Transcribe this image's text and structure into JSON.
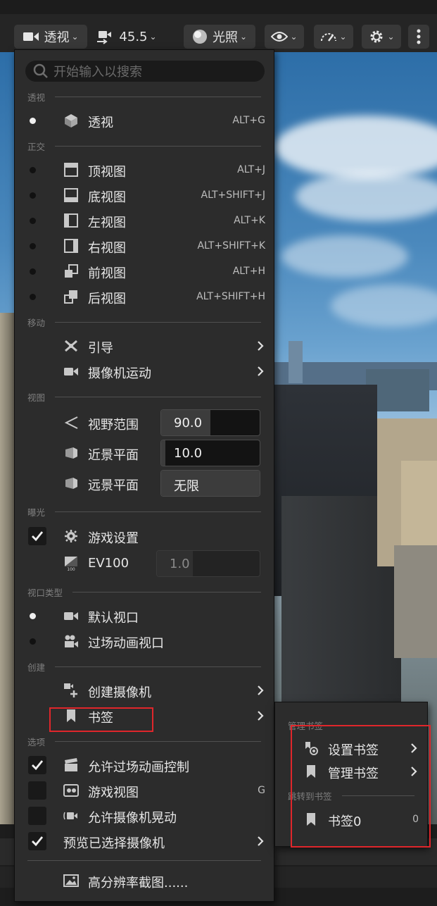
{
  "toolbar": {
    "perspective_label": "透视",
    "camera_speed": "45.5",
    "lighting_label": "光照"
  },
  "menu": {
    "search_placeholder": "开始输入以搜索",
    "sections": {
      "perspective": "透视",
      "ortho": "正交",
      "move": "移动",
      "view": "视图",
      "exposure": "曝光",
      "viewport_type": "视口类型",
      "create": "创建",
      "options": "选项"
    },
    "perspective": {
      "label": "透视",
      "shortcut": "ALT+G",
      "selected": true
    },
    "ortho_items": [
      {
        "label": "顶视图",
        "shortcut": "ALT+J",
        "icon": "top-view-icon"
      },
      {
        "label": "底视图",
        "shortcut": "ALT+SHIFT+J",
        "icon": "bottom-view-icon"
      },
      {
        "label": "左视图",
        "shortcut": "ALT+K",
        "icon": "left-view-icon"
      },
      {
        "label": "右视图",
        "shortcut": "ALT+SHIFT+K",
        "icon": "right-view-icon"
      },
      {
        "label": "前视图",
        "shortcut": "ALT+H",
        "icon": "front-view-icon"
      },
      {
        "label": "后视图",
        "shortcut": "ALT+SHIFT+H",
        "icon": "back-view-icon"
      }
    ],
    "move_items": [
      {
        "label": "引导",
        "icon": "pilot-icon"
      },
      {
        "label": "摄像机运动",
        "icon": "camera-movement-icon"
      }
    ],
    "view_items": [
      {
        "label": "视野范围",
        "value": "90.0",
        "fill": 0.5
      },
      {
        "label": "近景平面",
        "value": "10.0",
        "fill": 0.04
      },
      {
        "label": "远景平面",
        "value": "无限",
        "fill": 1.0
      }
    ],
    "exposure": {
      "game_settings_label": "游戏设置",
      "game_settings_checked": true,
      "ev100_label": "EV100",
      "ev100_icon_text": "100",
      "ev100_value": "1.0",
      "ev100_fill": 0.35
    },
    "viewport_types": [
      {
        "label": "默认视口",
        "selected": true
      },
      {
        "label": "过场动画视口",
        "selected": false
      }
    ],
    "create_items": [
      {
        "label": "创建摄像机"
      },
      {
        "label": "书签"
      }
    ],
    "options": [
      {
        "label": "允许过场动画控制",
        "checked": true,
        "shortcut": ""
      },
      {
        "label": "游戏视图",
        "checked": false,
        "shortcut": "G"
      },
      {
        "label": "允许摄像机晃动",
        "checked": false,
        "shortcut": ""
      },
      {
        "label": "预览已选择摄像机",
        "checked": true,
        "shortcut": ""
      }
    ],
    "screenshot_label": "高分辨率截图......"
  },
  "submenu": {
    "manage_section": "管理书签",
    "set_bookmark": "设置书签",
    "manage_bookmark": "管理书签",
    "jump_section": "跳转到书签",
    "bookmark0_label": "书签0",
    "bookmark0_shortcut": "0"
  },
  "colors": {
    "menu_bg": "#2c2c2c",
    "highlight_red": "#e0262b",
    "check_white": "#f0f0f0"
  }
}
